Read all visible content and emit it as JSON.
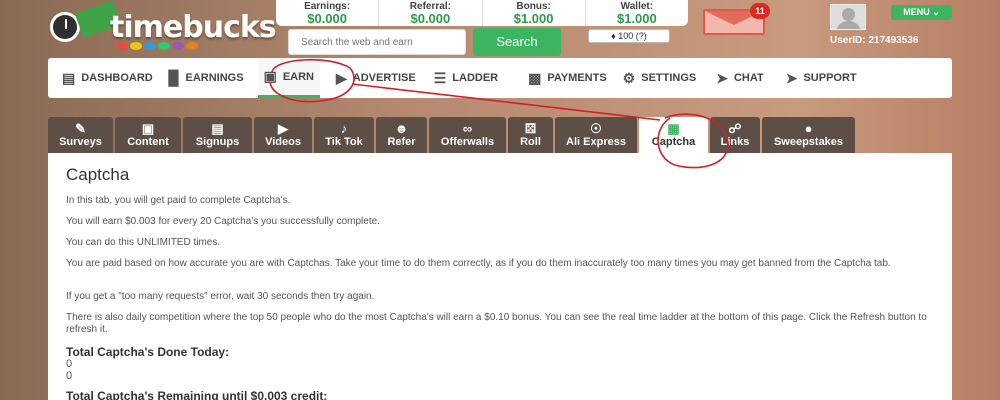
{
  "logo": {
    "text": "timebucks"
  },
  "stats": [
    {
      "label": "Earnings:",
      "value": "$0.000"
    },
    {
      "label": "Referral:",
      "value": "$0.000"
    },
    {
      "label": "Bonus:",
      "value": "$1.000"
    },
    {
      "label": "Wallet:",
      "value": "$1.000"
    }
  ],
  "search": {
    "placeholder": "Search the web and earn",
    "button": "Search"
  },
  "tickets": "100 (?)",
  "messages": {
    "count": "11"
  },
  "menu": {
    "label": "MENU ⌄"
  },
  "user": {
    "id_text": "UserID: 217493536"
  },
  "nav": [
    {
      "label": "DASHBOARD",
      "icon": "dashboard-icon"
    },
    {
      "label": "EARNINGS",
      "icon": "bar-chart-icon"
    },
    {
      "label": "EARN",
      "icon": "dollar-screen-icon"
    },
    {
      "label": "ADVERTISE",
      "icon": "megaphone-icon"
    },
    {
      "label": "LADDER",
      "icon": "ladder-icon"
    },
    {
      "label": "PAYMENTS",
      "icon": "wallet-icon"
    },
    {
      "label": "SETTINGS",
      "icon": "gear-icon"
    },
    {
      "label": "CHAT",
      "icon": "send-icon"
    },
    {
      "label": "SUPPORT",
      "icon": "send-icon"
    }
  ],
  "tabs": [
    {
      "label": "Surveys",
      "icon": "pencil-icon"
    },
    {
      "label": "Content",
      "icon": "window-icon"
    },
    {
      "label": "Signups",
      "icon": "clipboard-icon"
    },
    {
      "label": "Videos",
      "icon": "video-icon"
    },
    {
      "label": "Tik Tok",
      "icon": "tiktok-icon"
    },
    {
      "label": "Refer",
      "icon": "users-icon"
    },
    {
      "label": "Offerwalls",
      "icon": "share-icon"
    },
    {
      "label": "Roll",
      "icon": "dice-icon"
    },
    {
      "label": "Ali Express",
      "icon": "dollar-circle-icon"
    },
    {
      "label": "Captcha",
      "icon": "captcha-icon"
    },
    {
      "label": "Links",
      "icon": "link-icon"
    },
    {
      "label": "Sweepstakes",
      "icon": "money-bag-icon"
    }
  ],
  "content": {
    "title": "Captcha",
    "paragraphs": [
      "In this tab, you will get paid to complete Captcha's.",
      "You will earn $0.003 for every 20 Captcha's you successfully complete.",
      "You can do this UNLIMITED times.",
      "You are paid based on how accurate you are with Captchas. Take your time to do them correctly, as if you do them inaccurately too many times you may get banned from the Captcha tab.",
      "If you get a \"too many requests\" error, wait 30 seconds then try again.",
      "There is also daily competition where the top 50 people who do the most Captcha's will earn a $0.10 bonus. You can see the real time ladder at the bottom of this page. Click the Refresh button to refresh it."
    ],
    "done_today_label": "Total Captcha's Done Today:",
    "done_today_values": [
      "0",
      "0"
    ],
    "remaining_label": "Total Captcha's Remaining until $0.003 credit:"
  },
  "colors": {
    "accent": "#3bb55f",
    "tab_bg": "#5e4f46",
    "annotation": "#d0202a"
  }
}
